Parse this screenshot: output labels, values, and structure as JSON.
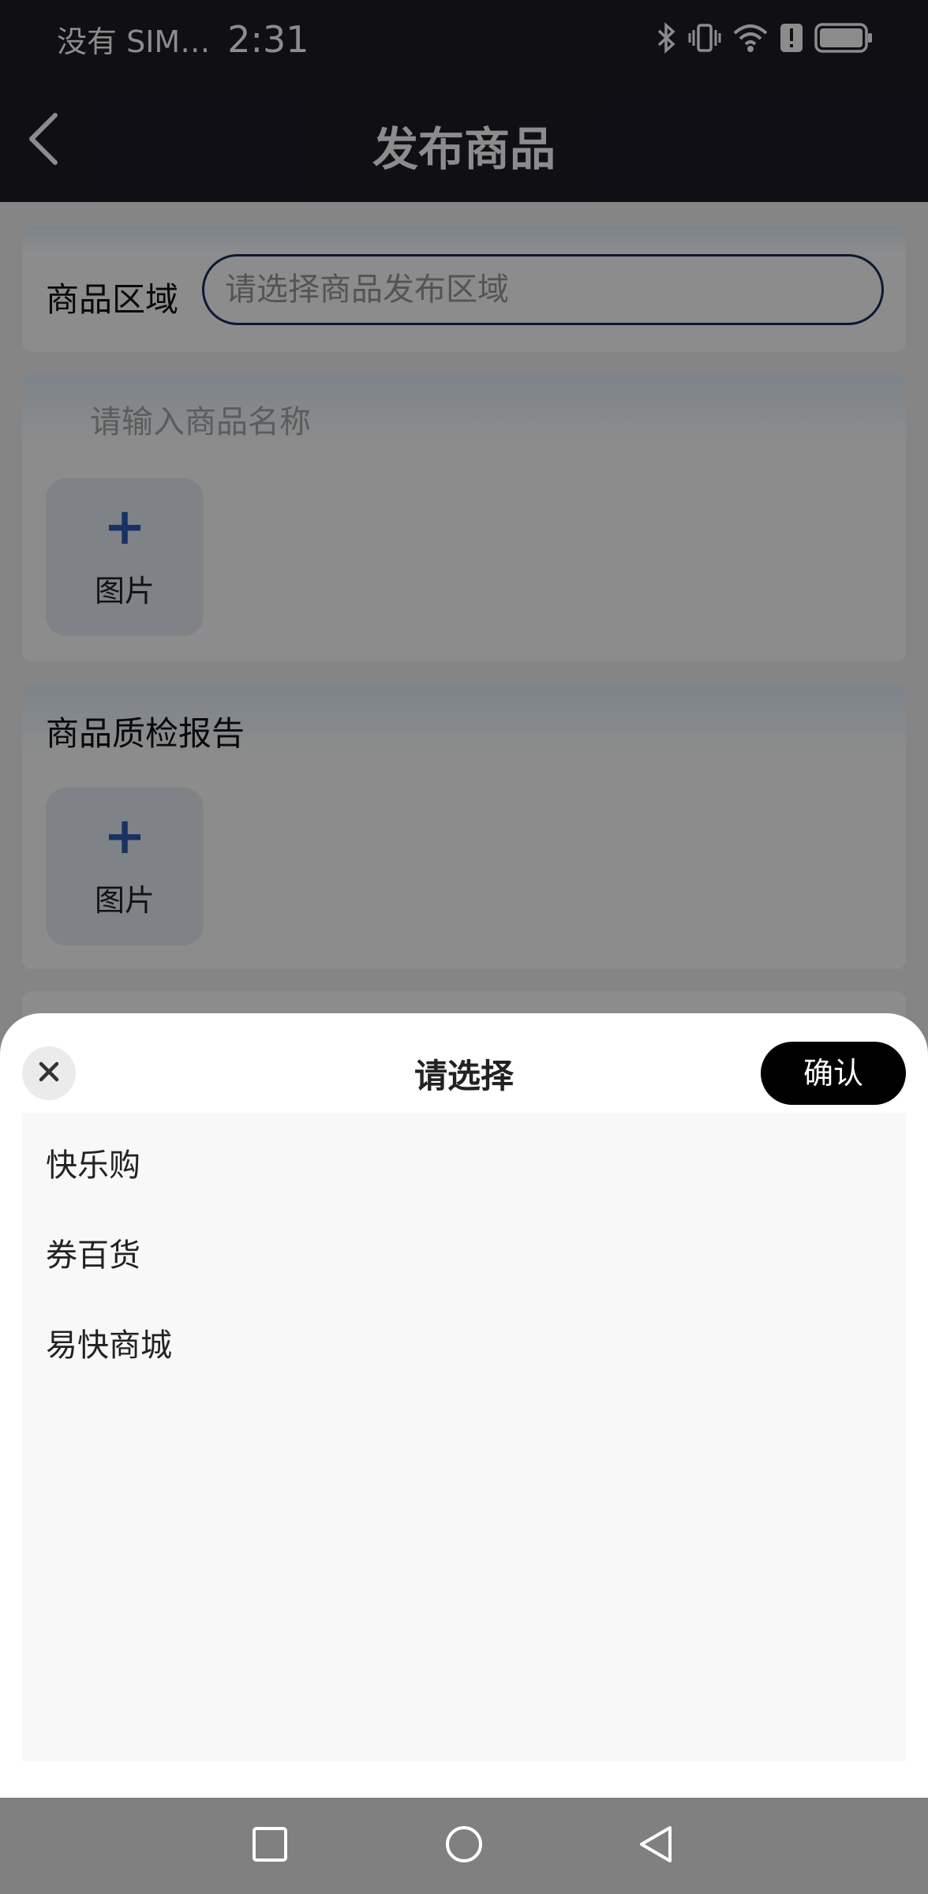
{
  "status_bar": {
    "carrier": "没有 SIM…",
    "time": "2:31",
    "icons": [
      "bluetooth-icon",
      "vibrate-icon",
      "wifi-icon",
      "alert-icon",
      "battery-icon"
    ]
  },
  "nav": {
    "title": "发布商品",
    "back_icon": "chevron-left-icon"
  },
  "form": {
    "area_label": "商品区域",
    "area_placeholder": "请选择商品发布区域",
    "name_placeholder": "请输入商品名称",
    "image_upload": {
      "icon": "plus-icon",
      "plus": "+",
      "label": "图片"
    },
    "report_title": "商品质检报告",
    "report_upload": {
      "icon": "plus-icon",
      "plus": "+",
      "label": "图片"
    }
  },
  "picker": {
    "title": "请选择",
    "confirm_label": "确认",
    "close_icon": "close-icon",
    "options": [
      "快乐购",
      "券百货",
      "易快商城"
    ]
  },
  "system_nav": {
    "icons": [
      "square-recents-icon",
      "circle-home-icon",
      "triangle-back-icon"
    ]
  },
  "colors": {
    "header_bg": "#1c1c26",
    "input_border": "#1a2d5c",
    "accent_blue": "#2a5bb5",
    "confirm_bg": "#000000"
  }
}
